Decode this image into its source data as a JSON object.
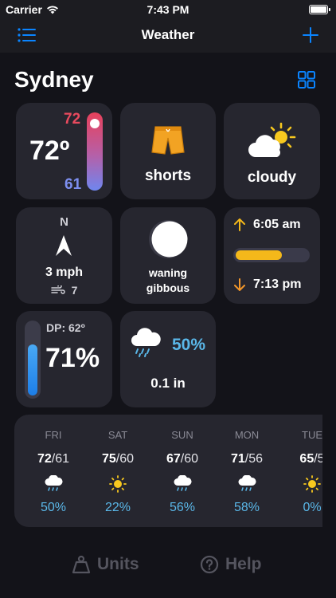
{
  "status": {
    "carrier": "Carrier",
    "time": "7:43 PM"
  },
  "nav": {
    "title": "Weather",
    "list_icon": "list-icon",
    "add_icon": "plus-icon"
  },
  "city": "Sydney",
  "temp_card": {
    "high": "72",
    "current": "72º",
    "low": "61",
    "position": 0.05
  },
  "outfit_card": {
    "label": "shorts",
    "icon": "shorts-icon"
  },
  "condition_card": {
    "label": "cloudy",
    "icon": "partly-cloudy-icon"
  },
  "wind_card": {
    "direction": "N",
    "speed": "3 mph",
    "gust": "7"
  },
  "moon_card": {
    "line1": "waning",
    "line2": "gibbous",
    "icon": "moon-icon"
  },
  "sun_card": {
    "sunrise": "6:05 am",
    "sunset": "7:13 pm",
    "progress": 0.64
  },
  "humidity_card": {
    "dew_point": "DP: 62º",
    "value": "71%",
    "fill": 0.71
  },
  "rain_card": {
    "probability": "50%",
    "amount": "0.1 in"
  },
  "forecast": [
    {
      "day": "FRI",
      "high": "72",
      "low": "/61",
      "icon": "rain",
      "pop": "50%"
    },
    {
      "day": "SAT",
      "high": "75",
      "low": "/60",
      "icon": "sun",
      "pop": "22%"
    },
    {
      "day": "SUN",
      "high": "67",
      "low": "/60",
      "icon": "rain",
      "pop": "56%"
    },
    {
      "day": "MON",
      "high": "71",
      "low": "/56",
      "icon": "rain",
      "pop": "58%"
    },
    {
      "day": "TUE",
      "high": "65",
      "low": "/5",
      "icon": "sun",
      "pop": "0%"
    }
  ],
  "bottom": {
    "units_label": "Units",
    "help_label": "Help"
  },
  "colors": {
    "accent": "#0a84ff",
    "high": "#e94a5e",
    "low": "#7d8ff0",
    "rain": "#5ab7e8",
    "sun": "#f4b81a"
  }
}
